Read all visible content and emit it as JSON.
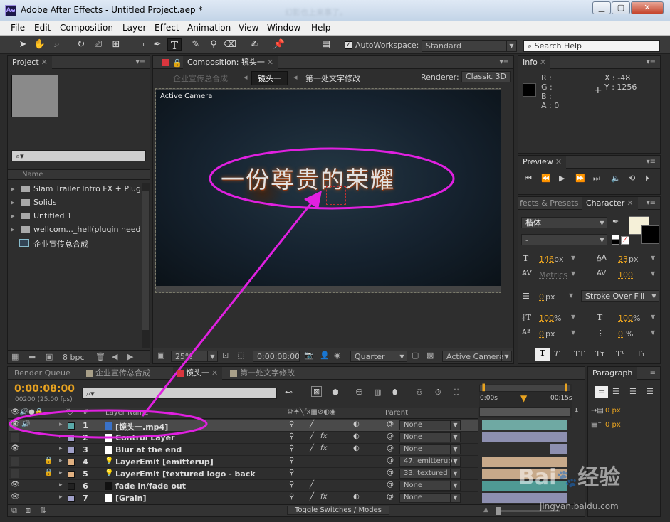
{
  "window": {
    "title": "Adobe After Effects - Untitled Project.aep *",
    "app_icon_text": "Ae",
    "behind_title": "幻影也上来事了。",
    "min": "▁",
    "max": "▢",
    "close": "✕"
  },
  "menu": [
    "File",
    "Edit",
    "Composition",
    "Layer",
    "Effect",
    "Animation",
    "View",
    "Window",
    "Help"
  ],
  "toolbar": {
    "autoworkspace_label": "AutoWorkspace:",
    "workspace_value": "Standard",
    "search_help": "Search Help"
  },
  "project": {
    "tab": "Project",
    "column_name": "Name",
    "items": [
      {
        "label": "Slam Trailer Intro FX + Plug-in",
        "type": "folder"
      },
      {
        "label": "Solids",
        "type": "folder"
      },
      {
        "label": "Untitled 1",
        "type": "folder"
      },
      {
        "label": "wellcom..._hell(plugin needed)",
        "type": "folder"
      },
      {
        "label": "企业宣传总合成",
        "type": "comp"
      }
    ],
    "bpc": "8 bpc"
  },
  "composition": {
    "tab": "Composition: 镜头一",
    "breadcrumb": [
      "企业宣传总合成",
      "镜头一",
      "第一处文字修改"
    ],
    "renderer_label": "Renderer:",
    "renderer_value": "Classic 3D",
    "viewer_label": "Active Camera",
    "frame_text": "一份尊贵的荣耀",
    "zoom": "25%",
    "timecode": "0:00:08:00",
    "resolution": "Quarter",
    "camera": "Active Camera"
  },
  "info": {
    "tab": "Info",
    "r": "R :",
    "g": "G :",
    "b": "B :",
    "a": "A : 0",
    "x": "X : -48",
    "y": "Y : 1256"
  },
  "preview": {
    "tab": "Preview"
  },
  "character": {
    "tab_effects": "fects & Presets",
    "tab": "Character",
    "font": "楷体",
    "style": "-",
    "size": "146",
    "size_unit": "px",
    "leading": "23",
    "leading_unit": "px",
    "kerning": "Metrics",
    "tracking": "100",
    "stroke_width": "0",
    "stroke_unit": "px",
    "stroke_mode": "Stroke Over Fill",
    "vscale": "100",
    "vscale_unit": "%",
    "hscale": "100",
    "hscale_unit": "%",
    "baseline": "0",
    "baseline_unit": "px",
    "tsume": "0",
    "tsume_unit": "%",
    "style_buttons": [
      "T",
      "T",
      "TT",
      "Tт",
      "T¹",
      "T₁"
    ]
  },
  "paragraph": {
    "tab": "Paragraph",
    "indent1": "0 px",
    "indent2": "0 px"
  },
  "timeline": {
    "tabs": [
      "Render Queue",
      "企业宣传总合成",
      "镜头一",
      "第一处文字修改"
    ],
    "timecode": "0:00:08:00",
    "frame_info": "00200 (25.00 fps)",
    "col_layer_name": "Layer Name",
    "col_parent": "Parent",
    "col_num": "#",
    "ruler_start": "0:00s",
    "ruler_end": "00:15s",
    "toggle": "Toggle Switches / Modes",
    "layers": [
      {
        "num": "1",
        "name": "[镜头一.mp4]",
        "color": "#5aa8a8",
        "parent": "None"
      },
      {
        "num": "2",
        "name": "Control Layer",
        "color": "#a0a0c8",
        "parent": "None"
      },
      {
        "num": "3",
        "name": "Blur at the end",
        "color": "#a0a0c8",
        "parent": "None"
      },
      {
        "num": "4",
        "name": "LayerEmit [emitterup]",
        "color": "#e0b080",
        "parent": "47. emitterup"
      },
      {
        "num": "5",
        "name": "LayerEmit [textured logo - back",
        "color": "#e0b080",
        "parent": "33. textured"
      },
      {
        "num": "6",
        "name": "fade in/fade out",
        "color": "#222222",
        "parent": "None"
      },
      {
        "num": "7",
        "name": "[Grain]",
        "color": "#a0a0c8",
        "parent": "None"
      }
    ]
  },
  "watermark": {
    "brand": "Bai",
    "brand2": "经验",
    "url": "jingyan.baidu.com"
  },
  "colors": {
    "annotation": "#e020e0",
    "timecode": "#e8a320",
    "playhead": "#e02020"
  }
}
